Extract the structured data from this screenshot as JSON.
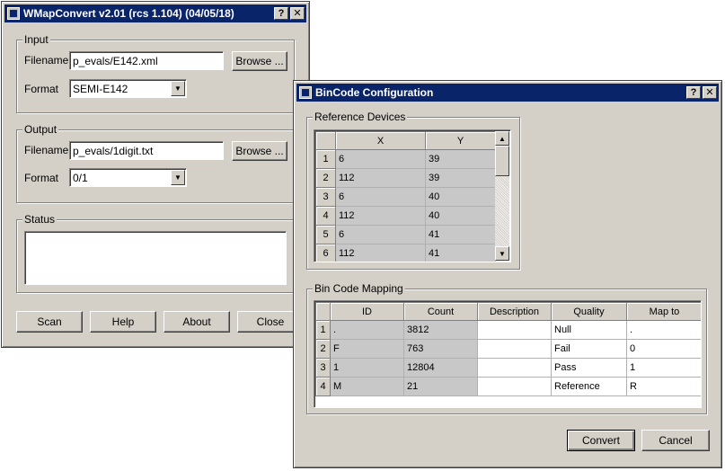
{
  "main": {
    "title": "WMapConvert v2.01 (rcs 1.104) (04/05/18)",
    "help_btn": "?",
    "close_btn": "✕",
    "input": {
      "group_title": "Input",
      "filename_label": "Filename",
      "filename_value": "p_evals/E142.xml",
      "browse_label": "Browse ...",
      "format_label": "Format",
      "format_value": "SEMI-E142"
    },
    "output": {
      "group_title": "Output",
      "filename_label": "Filename",
      "filename_value": "p_evals/1digit.txt",
      "browse_label": "Browse ...",
      "format_label": "Format",
      "format_value": "0/1"
    },
    "status": {
      "group_title": "Status"
    },
    "buttons": {
      "scan": "Scan",
      "help": "Help",
      "about": "About",
      "close": "Close"
    }
  },
  "bincode": {
    "title": "BinCode Configuration",
    "help_btn": "?",
    "close_btn": "✕",
    "ref_devices": {
      "group_title": "Reference Devices",
      "columns": [
        "X",
        "Y"
      ],
      "rows": [
        {
          "n": "1",
          "x": "6",
          "y": "39"
        },
        {
          "n": "2",
          "x": "112",
          "y": "39"
        },
        {
          "n": "3",
          "x": "6",
          "y": "40"
        },
        {
          "n": "4",
          "x": "112",
          "y": "40"
        },
        {
          "n": "5",
          "x": "6",
          "y": "41"
        },
        {
          "n": "6",
          "x": "112",
          "y": "41"
        }
      ]
    },
    "mapping": {
      "group_title": "Bin Code Mapping",
      "columns": [
        "ID",
        "Count",
        "Description",
        "Quality",
        "Map to"
      ],
      "rows": [
        {
          "n": "1",
          "id": ".",
          "count": "3812",
          "description": "",
          "quality": "Null",
          "map_to": "."
        },
        {
          "n": "2",
          "id": "F",
          "count": "763",
          "description": "",
          "quality": "Fail",
          "map_to": "0"
        },
        {
          "n": "3",
          "id": "1",
          "count": "12804",
          "description": "",
          "quality": "Pass",
          "map_to": "1"
        },
        {
          "n": "4",
          "id": "M",
          "count": "21",
          "description": "",
          "quality": "Reference",
          "map_to": "R"
        }
      ]
    },
    "buttons": {
      "convert": "Convert",
      "cancel": "Cancel"
    }
  }
}
